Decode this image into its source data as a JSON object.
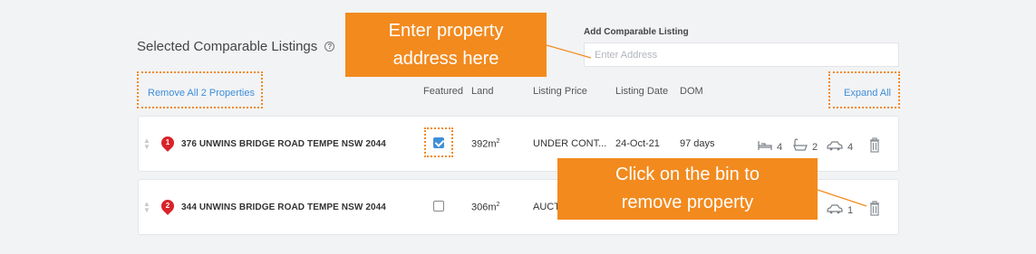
{
  "header": {
    "section_title": "Selected Comparable Listings",
    "help_icon": "?",
    "add_label": "Add Comparable Listing",
    "add_placeholder": "Enter Address",
    "remove_all": "Remove All 2 Properties",
    "expand_all": "Expand All"
  },
  "columns": {
    "featured": "Featured",
    "land": "Land",
    "listing_price": "Listing Price",
    "listing_date": "Listing Date",
    "dom": "DOM"
  },
  "rows": [
    {
      "index": "1",
      "address": "376 UNWINS BRIDGE ROAD TEMPE NSW 2044",
      "featured": true,
      "land": "392m",
      "land_unit": "2",
      "price": "UNDER CONT...",
      "date": "24-Oct-21",
      "dom": "97 days",
      "beds": "4",
      "baths": "2",
      "cars": "4"
    },
    {
      "index": "2",
      "address": "344 UNWINS BRIDGE ROAD TEMPE NSW 2044",
      "featured": false,
      "land": "306m",
      "land_unit": "2",
      "price": "AUCT",
      "cars": "1"
    }
  ],
  "callouts": {
    "address_line1": "Enter property",
    "address_line2": "address here",
    "bin_line1": "Click on the bin to",
    "bin_line2": "remove property"
  },
  "colors": {
    "accent_orange": "#f28a1e",
    "link_blue": "#3f8fd8",
    "pin_red": "#d9232a"
  },
  "icons": [
    "help-icon",
    "drag-handle-icon",
    "map-pin-icon",
    "checkbox-icon",
    "bed-icon",
    "bath-icon",
    "car-icon",
    "trash-bin-icon"
  ]
}
